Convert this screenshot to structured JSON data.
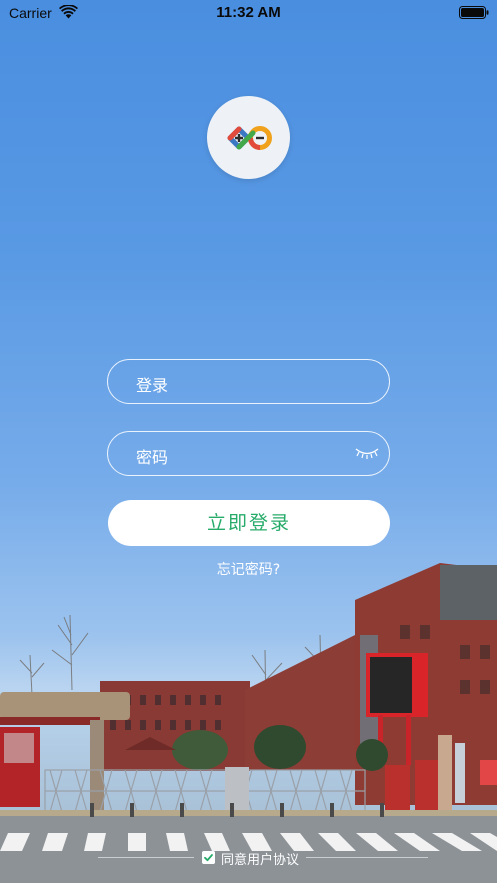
{
  "status_bar": {
    "carrier": "Carrier",
    "time": "11:32 AM"
  },
  "logo": {
    "icon": "infinity-plus-minus-logo"
  },
  "form": {
    "account_placeholder": "登录",
    "password_placeholder": "密码",
    "password_toggle_icon": "eye-closed-icon",
    "login_button": "立即登录",
    "forgot_password": "忘记密码?"
  },
  "agreement": {
    "checked": true,
    "label": "同意用户协议"
  },
  "colors": {
    "background_top": "#4a8ee0",
    "accent_green": "#27ab6a",
    "text_white": "#ffffff"
  }
}
